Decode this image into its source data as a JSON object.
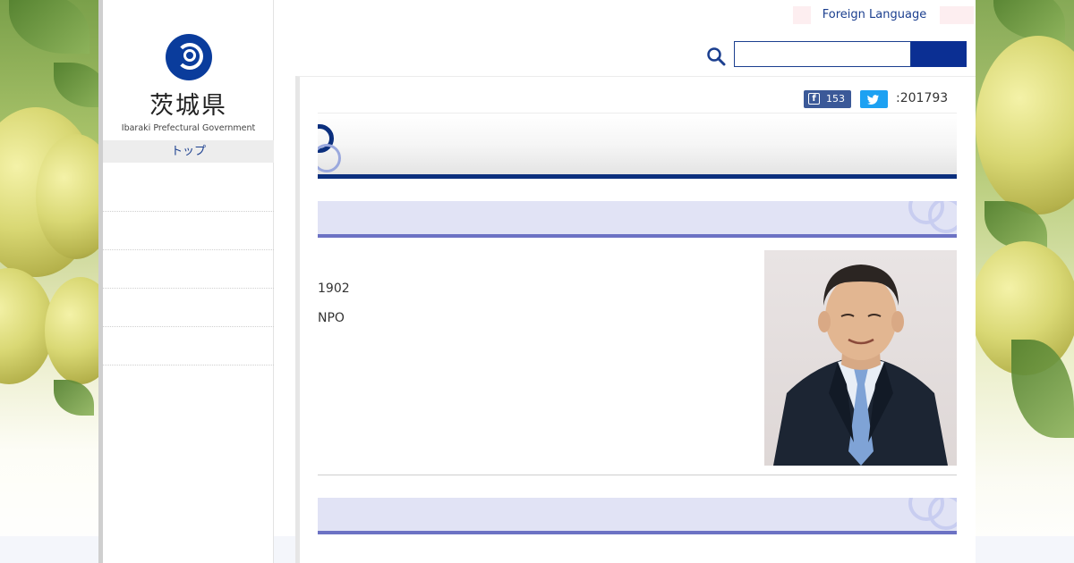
{
  "header": {
    "foreign_language": "Foreign Language",
    "search_placeholder": ""
  },
  "logo": {
    "kanji": "茨城県",
    "english": "Ibaraki Prefectural Government"
  },
  "nav": {
    "top_label": "トップ",
    "items": [
      "",
      "",
      "",
      "",
      ""
    ]
  },
  "share": {
    "facebook_count": "153",
    "page_id": ":201793"
  },
  "content": {
    "line1": "1902",
    "line2": "NPO"
  },
  "colors": {
    "brand_blue": "#0b2f7d",
    "facebook": "#3b5998",
    "twitter": "#1da1f2",
    "subheading_bg": "#e1e3f5",
    "subheading_border": "#6c72c4"
  },
  "icons": [
    "search-icon",
    "facebook-icon",
    "twitter-icon",
    "prefecture-logo-icon"
  ]
}
